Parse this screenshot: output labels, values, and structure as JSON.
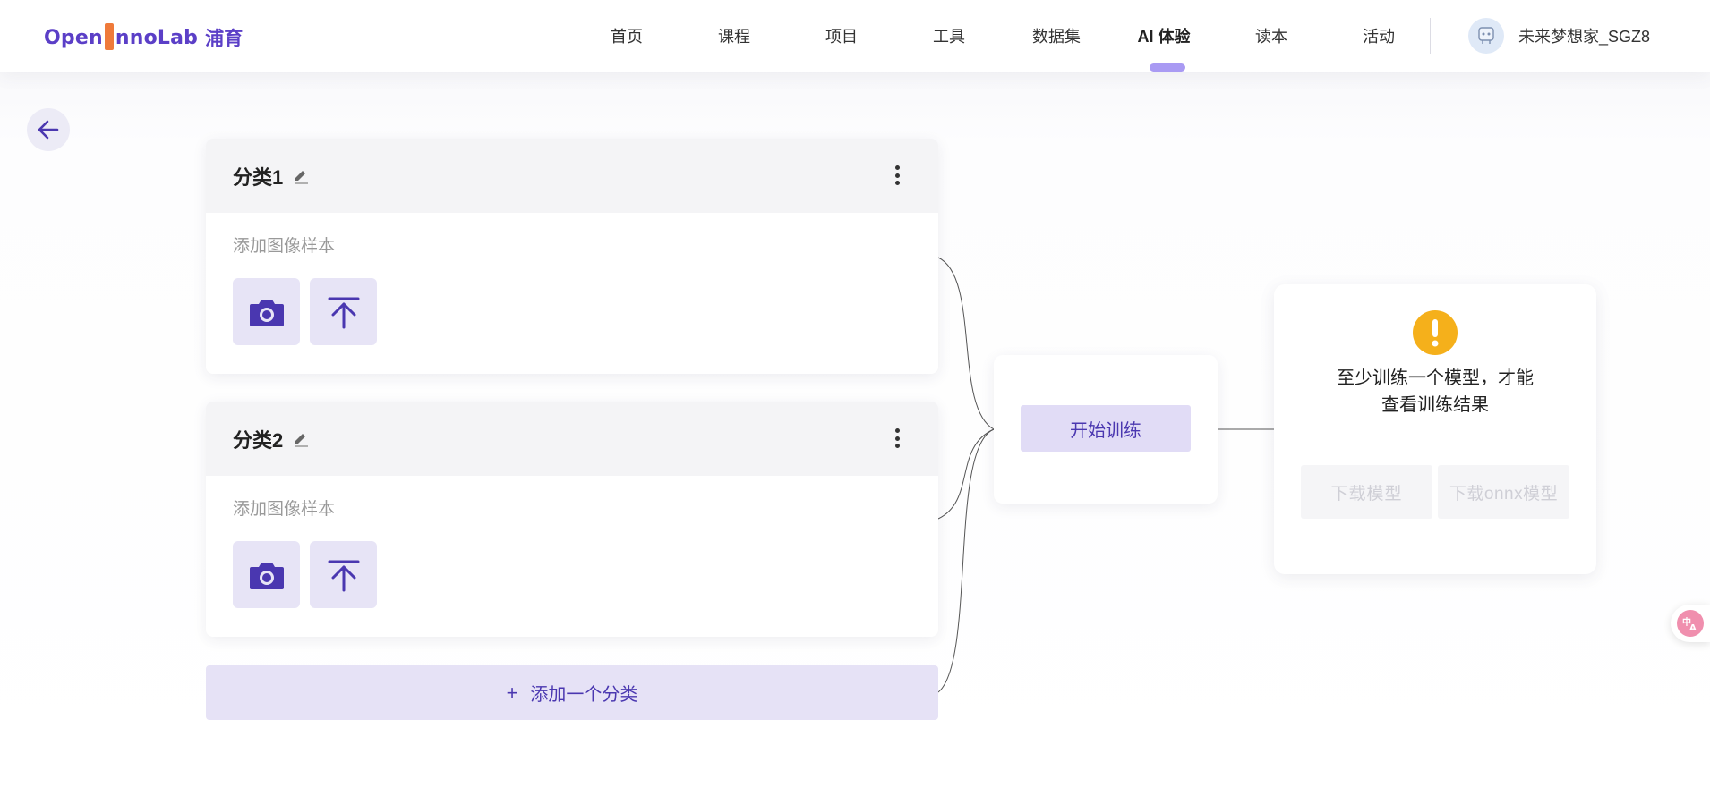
{
  "header": {
    "logo_text": "OpenInnoLab",
    "logo_cn": "浦育",
    "nav": [
      {
        "label": "首页"
      },
      {
        "label": "课程"
      },
      {
        "label": "项目"
      },
      {
        "label": "工具"
      },
      {
        "label": "数据集"
      },
      {
        "label": "AI 体验",
        "active": true
      },
      {
        "label": "读本"
      },
      {
        "label": "活动"
      }
    ],
    "username": "未来梦想家_SGZ8"
  },
  "classes": [
    {
      "title": "分类1",
      "sample_label": "添加图像样本"
    },
    {
      "title": "分类2",
      "sample_label": "添加图像样本"
    }
  ],
  "add_class_label": "添加一个分类",
  "train": {
    "button_label": "开始训练"
  },
  "result": {
    "message_line1": "至少训练一个模型，才能",
    "message_line2": "查看训练结果",
    "download_model": "下载模型",
    "download_onnx": "下载onnx模型"
  },
  "colors": {
    "accent": "#4a37b0",
    "accent_light": "#e6e2f6",
    "warning": "#f5b01b",
    "nav_indicator": "#a99af3"
  },
  "icons": {
    "back": "arrow-left-icon",
    "camera": "camera-icon",
    "upload": "upload-icon",
    "edit": "pencil-icon",
    "more": "more-vertical-icon",
    "warning": "exclamation-icon",
    "translate": "translate-icon"
  }
}
